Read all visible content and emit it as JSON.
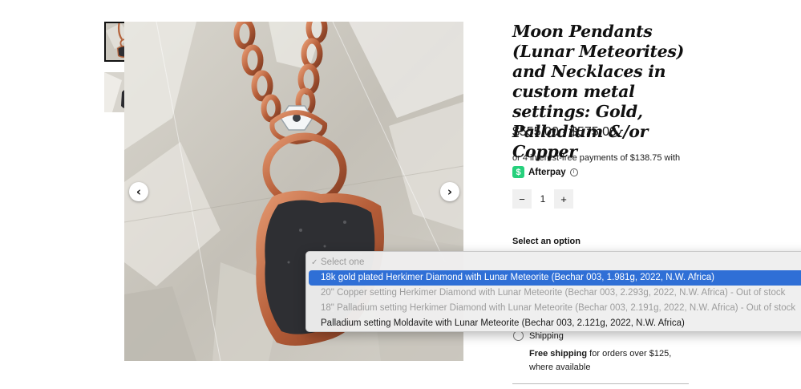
{
  "gallery": {
    "thumbnails": [
      "thumbnail-1",
      "thumbnail-2"
    ],
    "prev_icon": "‹",
    "next_icon": "›"
  },
  "product": {
    "title": "Moon Pendants (Lunar Meteorites) and Necklaces in custom metal settings: Gold, Palladium &/or Copper",
    "price": "$555.00 - $575.00",
    "installments": "or 4 interest-free payments of $138.75 with",
    "afterpay_icon": "$",
    "afterpay_label": "Afterpay",
    "info_icon": "i"
  },
  "quantity": {
    "minus": "−",
    "value": "1",
    "plus": "+"
  },
  "options": {
    "label": "Select an option",
    "check_mark": "✓",
    "placeholder": "Select one",
    "items": [
      "18k gold plated Herkimer Diamond with Lunar Meteorite (Bechar 003, 1.981g, 2022, N.W. Africa)",
      "20\" Copper setting Herkimer Diamond with Lunar Meteorite (Bechar 003, 2.293g, 2022, N.W. Africa) - Out of stock",
      "18\" Palladium setting Herkimer Diamond with Lunar Meteorite (Bechar 003, 2.191g, 2022, N.W. Africa) - Out of stock",
      "Palladium setting Moldavite with Lunar Meteorite (Bechar 003, 2.121g, 2022, N.W. Africa)"
    ]
  },
  "shipping": {
    "label": "Shipping",
    "free_bold": "Free shipping",
    "free_rest": " for orders over $125, where available"
  },
  "colors": {
    "accent_selected": "#2f6fd6",
    "afterpay_green": "#26d07c"
  }
}
